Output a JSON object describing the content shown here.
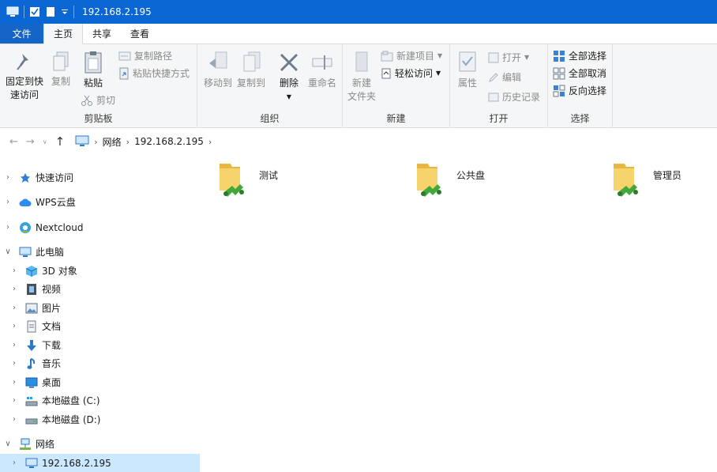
{
  "window": {
    "title": "192.168.2.195",
    "accent_color": "#0a66d3"
  },
  "tabs": {
    "file": "文件",
    "home": "主页",
    "share": "共享",
    "view": "查看"
  },
  "ribbon": {
    "clipboard": {
      "label": "剪贴板",
      "pin": "固定到快\n速访问",
      "pin_line1": "固定到快",
      "pin_line2": "速访问",
      "copy": "复制",
      "paste": "粘贴",
      "copy_path": "复制路径",
      "paste_shortcut": "粘贴快捷方式",
      "cut": "剪切"
    },
    "organize": {
      "label": "组织",
      "move_to": "移动到",
      "copy_to": "复制到",
      "delete": "删除",
      "rename": "重命名"
    },
    "new": {
      "label": "新建",
      "new_folder_line1": "新建",
      "new_folder_line2": "文件夹",
      "new_item": "新建项目",
      "easy_access": "轻松访问"
    },
    "open": {
      "label": "打开",
      "properties": "属性",
      "open": "打开",
      "edit": "编辑",
      "history": "历史记录"
    },
    "select": {
      "label": "选择",
      "select_all": "全部选择",
      "select_none": "全部取消",
      "invert": "反向选择"
    }
  },
  "address": {
    "segments": [
      "网络",
      "192.168.2.195"
    ]
  },
  "nav_pane": {
    "items": [
      {
        "label": "快速访问",
        "icon": "star-icon"
      },
      {
        "label": "WPS云盘",
        "icon": "cloud-icon"
      },
      {
        "label": "Nextcloud",
        "icon": "nextcloud-icon"
      },
      {
        "label": "此电脑",
        "icon": "computer-icon"
      },
      {
        "label": "3D 对象",
        "icon": "cube-icon"
      },
      {
        "label": "视频",
        "icon": "video-icon"
      },
      {
        "label": "图片",
        "icon": "pictures-icon"
      },
      {
        "label": "文档",
        "icon": "documents-icon"
      },
      {
        "label": "下载",
        "icon": "download-icon"
      },
      {
        "label": "音乐",
        "icon": "music-icon"
      },
      {
        "label": "桌面",
        "icon": "desktop-icon"
      },
      {
        "label": "本地磁盘 (C:)",
        "icon": "drive-c-icon"
      },
      {
        "label": "本地磁盘 (D:)",
        "icon": "drive-d-icon"
      },
      {
        "label": "网络",
        "icon": "network-icon"
      },
      {
        "label": "192.168.2.195",
        "icon": "computer-icon"
      }
    ]
  },
  "shares": [
    {
      "name": "测试",
      "icon": "shared-folder-icon"
    },
    {
      "name": "公共盘",
      "icon": "shared-folder-icon"
    },
    {
      "name": "管理员",
      "icon": "shared-folder-icon"
    }
  ]
}
